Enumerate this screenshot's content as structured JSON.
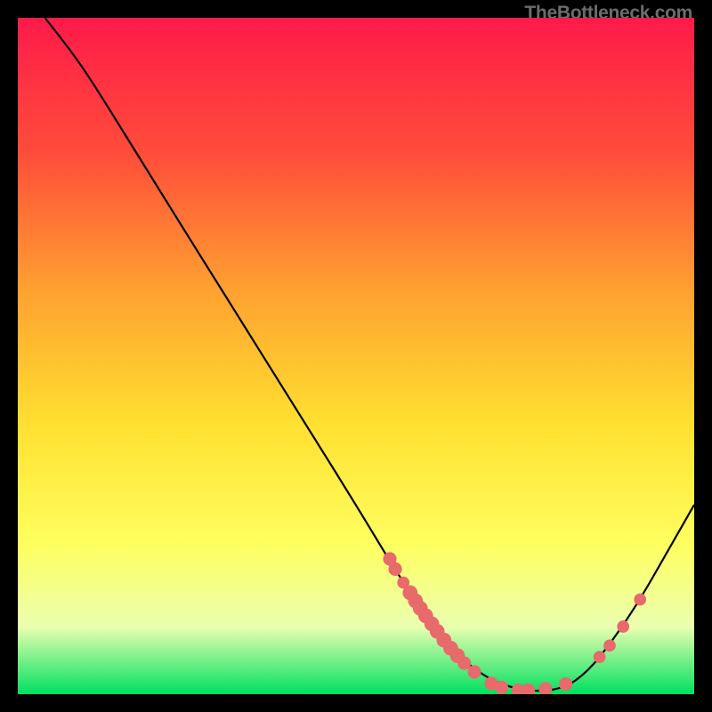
{
  "watermark": "TheBottleneck.com",
  "chart_data": {
    "type": "line",
    "title": "",
    "xlabel": "",
    "ylabel": "",
    "xlim": [
      0,
      100
    ],
    "ylim": [
      0,
      100
    ],
    "gradient_stops": [
      {
        "offset": 0,
        "color": "#ff1a4a"
      },
      {
        "offset": 20,
        "color": "#ff4d3a"
      },
      {
        "offset": 40,
        "color": "#ffa030"
      },
      {
        "offset": 60,
        "color": "#ffe030"
      },
      {
        "offset": 78,
        "color": "#ffff60"
      },
      {
        "offset": 90,
        "color": "#eaffb0"
      },
      {
        "offset": 100,
        "color": "#00e060"
      }
    ],
    "curve": [
      {
        "x": 4,
        "y": 100
      },
      {
        "x": 8,
        "y": 95
      },
      {
        "x": 12,
        "y": 89
      },
      {
        "x": 20,
        "y": 76
      },
      {
        "x": 30,
        "y": 60
      },
      {
        "x": 40,
        "y": 44
      },
      {
        "x": 50,
        "y": 28
      },
      {
        "x": 56,
        "y": 18
      },
      {
        "x": 62,
        "y": 9
      },
      {
        "x": 68,
        "y": 3
      },
      {
        "x": 74,
        "y": 0.5
      },
      {
        "x": 80,
        "y": 0.5
      },
      {
        "x": 84,
        "y": 3
      },
      {
        "x": 88,
        "y": 8
      },
      {
        "x": 92,
        "y": 14
      },
      {
        "x": 96,
        "y": 21
      },
      {
        "x": 100,
        "y": 28
      }
    ],
    "dots": [
      {
        "x": 55.0,
        "y": 20.0,
        "r": 1.0
      },
      {
        "x": 55.8,
        "y": 18.5,
        "r": 1.0
      },
      {
        "x": 57.0,
        "y": 16.5,
        "r": 0.9
      },
      {
        "x": 58.0,
        "y": 15.0,
        "r": 1.1
      },
      {
        "x": 58.8,
        "y": 13.8,
        "r": 1.1
      },
      {
        "x": 59.5,
        "y": 12.7,
        "r": 1.1
      },
      {
        "x": 60.3,
        "y": 11.6,
        "r": 1.1
      },
      {
        "x": 61.2,
        "y": 10.4,
        "r": 1.1
      },
      {
        "x": 62.0,
        "y": 9.3,
        "r": 1.1
      },
      {
        "x": 63.0,
        "y": 8.0,
        "r": 1.1
      },
      {
        "x": 64.0,
        "y": 6.8,
        "r": 1.1
      },
      {
        "x": 65.0,
        "y": 5.7,
        "r": 1.1
      },
      {
        "x": 66.0,
        "y": 4.6,
        "r": 1.0
      },
      {
        "x": 67.5,
        "y": 3.3,
        "r": 1.0
      },
      {
        "x": 70.0,
        "y": 1.6,
        "r": 1.0
      },
      {
        "x": 71.5,
        "y": 1.0,
        "r": 1.0
      },
      {
        "x": 74.0,
        "y": 0.6,
        "r": 1.0
      },
      {
        "x": 75.5,
        "y": 0.6,
        "r": 1.0
      },
      {
        "x": 78.0,
        "y": 0.8,
        "r": 1.0
      },
      {
        "x": 81.0,
        "y": 1.5,
        "r": 1.0
      },
      {
        "x": 86.0,
        "y": 5.5,
        "r": 0.9
      },
      {
        "x": 87.5,
        "y": 7.2,
        "r": 0.9
      },
      {
        "x": 89.5,
        "y": 10.0,
        "r": 0.9
      },
      {
        "x": 92.0,
        "y": 14.0,
        "r": 0.9
      }
    ]
  }
}
